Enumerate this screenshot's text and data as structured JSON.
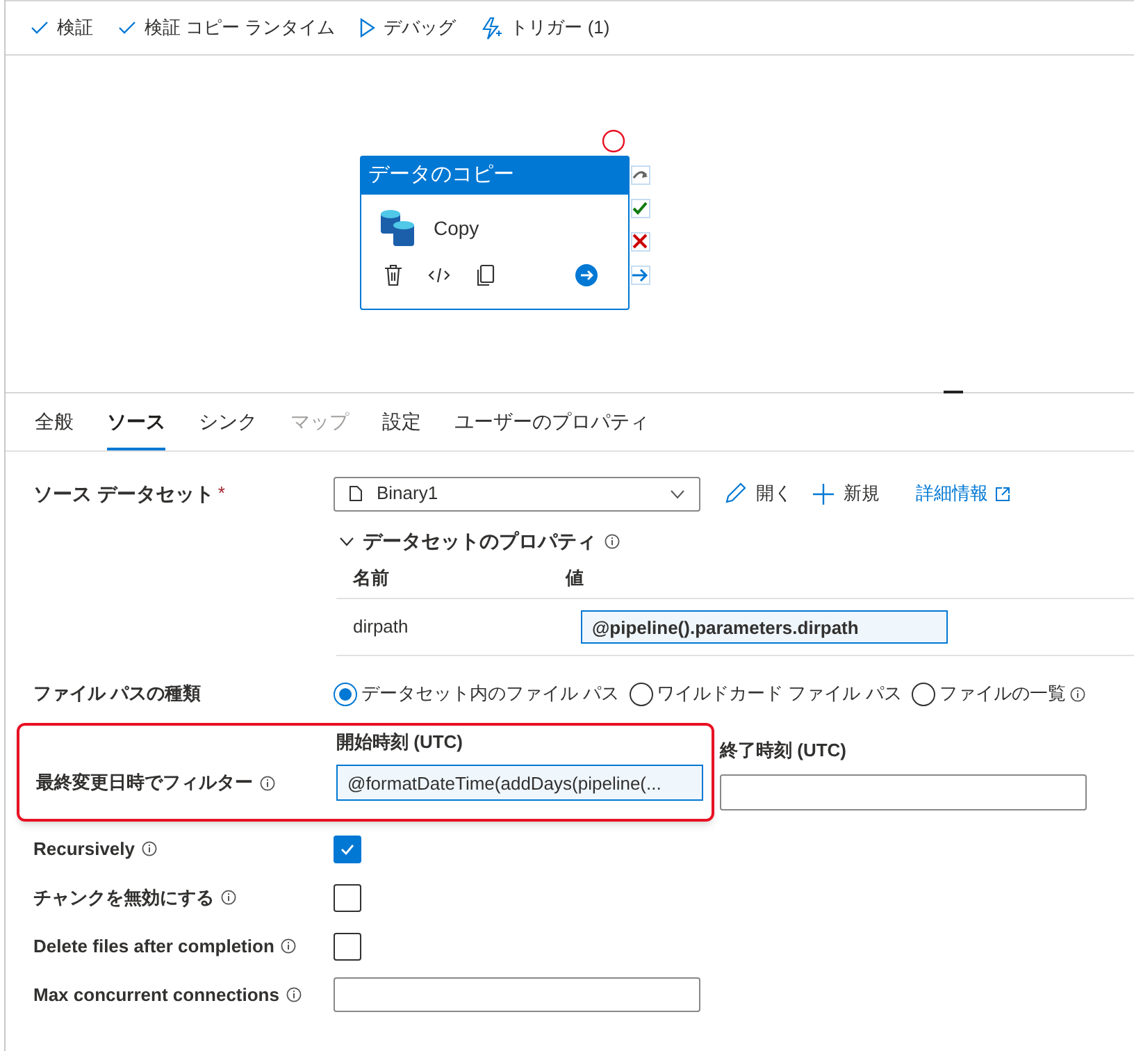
{
  "toolbar": [
    {
      "kind": "check",
      "label": "検証"
    },
    {
      "kind": "check",
      "label": "検証 コピー ランタイム"
    },
    {
      "kind": "play",
      "label": "デバッグ"
    },
    {
      "kind": "trigger",
      "label": "トリガー (1)"
    }
  ],
  "activity": {
    "title": "データのコピー",
    "name": "Copy"
  },
  "tabs": [
    {
      "label": "全般",
      "selected": false,
      "disabled": false
    },
    {
      "label": "ソース",
      "selected": true,
      "disabled": false
    },
    {
      "label": "シンク",
      "selected": false,
      "disabled": false
    },
    {
      "label": "マップ",
      "selected": false,
      "disabled": true
    },
    {
      "label": "設定",
      "selected": false,
      "disabled": false
    },
    {
      "label": "ユーザーのプロパティ",
      "selected": false,
      "disabled": false
    }
  ],
  "source_dataset": {
    "label": "ソース データセット",
    "required_mark": "*",
    "value": "Binary1",
    "actions": [
      {
        "kind": "edit",
        "label": "開く"
      },
      {
        "kind": "add",
        "label": "新規"
      }
    ],
    "link": "詳細情報"
  },
  "dataset_properties": {
    "title": "データセットのプロパティ",
    "expanded": true,
    "columns": [
      "名前",
      "値"
    ],
    "rows": [
      {
        "name": "dirpath",
        "value": "@pipeline().parameters.dirpath"
      }
    ]
  },
  "file_path_type": {
    "label": "ファイル パスの種類",
    "options": [
      {
        "label": "データセット内のファイル パス",
        "selected": true,
        "info": false
      },
      {
        "label": "ワイルドカード ファイル パス",
        "selected": false,
        "info": false
      },
      {
        "label": "ファイルの一覧",
        "selected": false,
        "info": true
      }
    ]
  },
  "last_modified_filter": {
    "label": "最終変更日時でフィルター",
    "highlighted": true,
    "start": {
      "label": "開始時刻 (UTC)",
      "value": "@formatDateTime(addDays(pipeline(..."
    },
    "end": {
      "label": "終了時刻 (UTC)"
    }
  },
  "options": [
    {
      "kind": "checkbox",
      "label": "Recursively",
      "checked": true
    },
    {
      "kind": "checkbox",
      "label": "チャンクを無効にする",
      "checked": false
    },
    {
      "kind": "checkbox",
      "label": "Delete files after completion",
      "checked": false
    },
    {
      "kind": "text",
      "label": "Max concurrent connections"
    }
  ]
}
